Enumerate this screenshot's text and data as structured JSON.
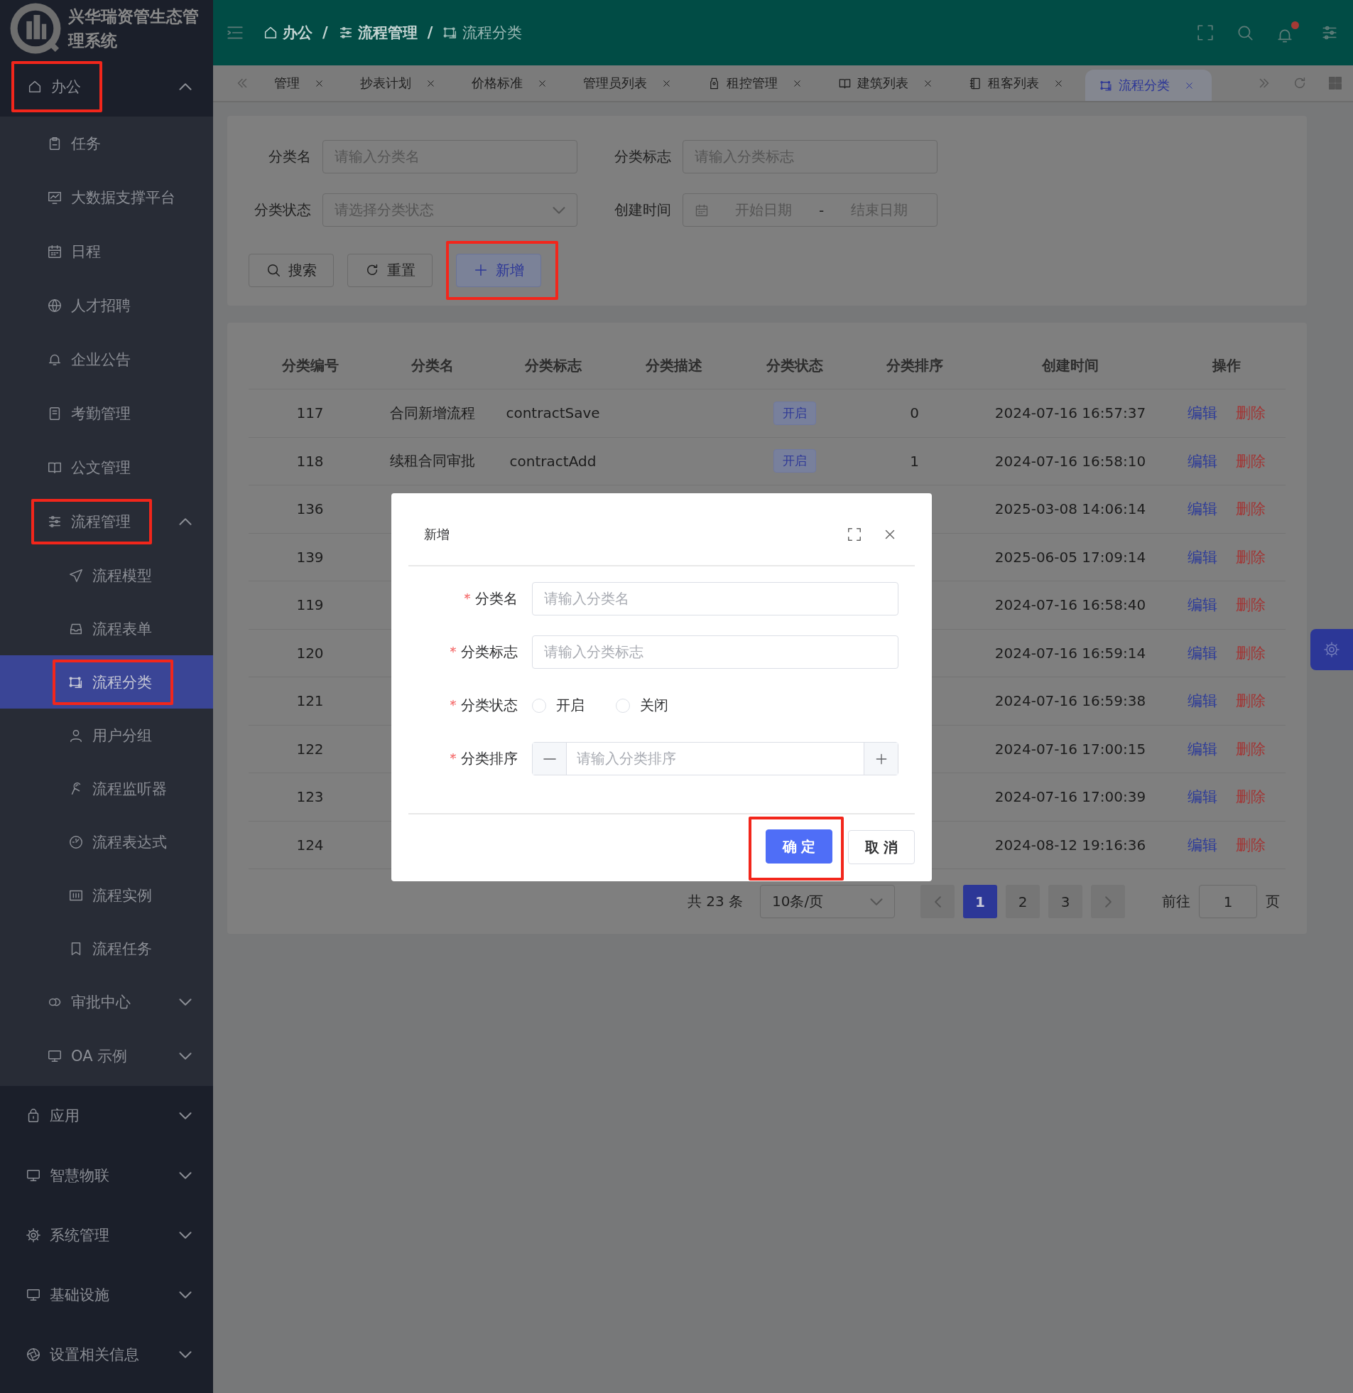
{
  "sidebar": {
    "title": "兴华瑞资管生态管理系统",
    "menu": [
      {
        "label": "办公",
        "expanded": true,
        "highlighted": true,
        "selected": false,
        "children": [
          {
            "label": "任务",
            "selected": false,
            "highlighted": false
          },
          {
            "label": "大数据支撑平台",
            "selected": false,
            "highlighted": false
          },
          {
            "label": "日程",
            "selected": false,
            "highlighted": false
          },
          {
            "label": "人才招聘",
            "selected": false,
            "highlighted": false
          },
          {
            "label": "企业公告",
            "selected": false,
            "highlighted": false
          },
          {
            "label": "考勤管理",
            "selected": false,
            "highlighted": false
          },
          {
            "label": "公文管理",
            "selected": false,
            "highlighted": false
          },
          {
            "label": "流程管理",
            "expanded": true,
            "highlighted": true,
            "selected": false,
            "children": [
              {
                "label": "流程模型",
                "selected": false,
                "highlighted": false
              },
              {
                "label": "流程表单",
                "selected": false,
                "highlighted": false
              },
              {
                "label": "流程分类",
                "selected": true,
                "highlighted": true
              },
              {
                "label": "用户分组",
                "selected": false,
                "highlighted": false
              },
              {
                "label": "流程监听器",
                "selected": false,
                "highlighted": false
              },
              {
                "label": "流程表达式",
                "selected": false,
                "highlighted": false
              },
              {
                "label": "流程实例",
                "selected": false,
                "highlighted": false
              },
              {
                "label": "流程任务",
                "selected": false,
                "highlighted": false
              }
            ]
          },
          {
            "label": "审批中心",
            "expanded": false,
            "highlighted": false,
            "selected": false
          },
          {
            "label": "OA 示例",
            "expanded": false,
            "highlighted": false,
            "selected": false
          }
        ]
      },
      {
        "label": "应用",
        "expanded": false,
        "highlighted": false,
        "selected": false
      },
      {
        "label": "智慧物联",
        "expanded": false,
        "highlighted": false,
        "selected": false
      },
      {
        "label": "系统管理",
        "expanded": false,
        "highlighted": false,
        "selected": false
      },
      {
        "label": "基础设施",
        "expanded": false,
        "highlighted": false,
        "selected": false
      },
      {
        "label": "设置相关信息",
        "expanded": false,
        "highlighted": false,
        "selected": false
      }
    ]
  },
  "breadcrumb": [
    {
      "label": "办公",
      "current": false
    },
    {
      "separator": "/",
      "label": "流程管理",
      "current": false
    },
    {
      "separator": "/",
      "label": "流程分类",
      "current": true
    }
  ],
  "header": {
    "notification_dot": true
  },
  "tabs": [
    {
      "label": "管理",
      "selected": false
    },
    {
      "label": "抄表计划",
      "selected": false
    },
    {
      "label": "价格标准",
      "selected": false
    },
    {
      "label": "管理员列表",
      "selected": false
    },
    {
      "label": "租控管理",
      "selected": false
    },
    {
      "label": "建筑列表",
      "selected": false
    },
    {
      "label": "租客列表",
      "selected": false
    },
    {
      "label": "流程分类",
      "selected": true
    }
  ],
  "filter": {
    "fields": [
      {
        "kind": "text",
        "label": "分类名",
        "placeholder": "请输入分类名"
      },
      {
        "kind": "text",
        "label": "分类标志",
        "placeholder": "请输入分类标志"
      },
      {
        "kind": "select",
        "label": "分类状态",
        "placeholder": "请选择分类状态"
      },
      {
        "kind": "daterange",
        "label": "创建时间",
        "start_placeholder": "开始日期",
        "separator": "-",
        "end_placeholder": "结束日期"
      }
    ],
    "buttons": [
      {
        "kind": "search",
        "label": "搜索",
        "highlighted": false
      },
      {
        "kind": "reset",
        "label": "重置",
        "highlighted": false
      },
      {
        "kind": "add",
        "label": "新增",
        "highlighted": true
      }
    ]
  },
  "table": {
    "columns": [
      "分类编号",
      "分类名",
      "分类标志",
      "分类描述",
      "分类状态",
      "分类排序",
      "创建时间",
      "操作"
    ],
    "rows": [
      {
        "id": "117",
        "name": "合同新增流程",
        "flag": "contractSave",
        "status": "开启",
        "sort": "0",
        "created": "2024-07-16 16:57:37",
        "actions": [
          "编辑",
          "删除"
        ]
      },
      {
        "id": "118",
        "name": "续租合同审批",
        "flag": "contractAdd",
        "status": "开启",
        "sort": "1",
        "created": "2024-07-16 16:58:10",
        "actions": [
          "编辑",
          "删除"
        ]
      },
      {
        "id": "136",
        "created": "2025-03-08 14:06:14",
        "actions": [
          "编辑",
          "删除"
        ]
      },
      {
        "id": "139",
        "created": "2025-06-05 17:09:14",
        "actions": [
          "编辑",
          "删除"
        ]
      },
      {
        "id": "119",
        "created": "2024-07-16 16:58:40",
        "actions": [
          "编辑",
          "删除"
        ]
      },
      {
        "id": "120",
        "created": "2024-07-16 16:59:14",
        "actions": [
          "编辑",
          "删除"
        ]
      },
      {
        "id": "121",
        "created": "2024-07-16 16:59:38",
        "actions": [
          "编辑",
          "删除"
        ]
      },
      {
        "id": "122",
        "created": "2024-07-16 17:00:15",
        "actions": [
          "编辑",
          "删除"
        ]
      },
      {
        "id": "123",
        "created": "2024-07-16 17:00:39",
        "actions": [
          "编辑",
          "删除"
        ]
      },
      {
        "id": "124",
        "created": "2024-08-12 19:16:36",
        "actions": [
          "编辑",
          "删除"
        ]
      }
    ]
  },
  "pagination": {
    "total": "共 23 条",
    "page_size": "10条/页",
    "pages": [
      {
        "label": "1",
        "selected": true
      },
      {
        "label": "2",
        "selected": false
      },
      {
        "label": "3",
        "selected": false
      }
    ],
    "goto_label": "前往",
    "goto_value": "1",
    "page_suffix": "页"
  },
  "dialog": {
    "title": "新增",
    "fields": [
      {
        "kind": "text",
        "label": "分类名",
        "required": true,
        "placeholder": "请输入分类名"
      },
      {
        "kind": "text",
        "label": "分类标志",
        "required": true,
        "placeholder": "请输入分类标志"
      },
      {
        "kind": "radio",
        "label": "分类状态",
        "required": true,
        "options": [
          {
            "label": "开启",
            "selected": false
          },
          {
            "label": "关闭",
            "selected": false
          }
        ]
      },
      {
        "kind": "number",
        "label": "分类排序",
        "required": true,
        "placeholder": "请输入分类排序"
      }
    ],
    "buttons": [
      {
        "kind": "primary",
        "label": "确 定",
        "highlighted": true
      },
      {
        "kind": "default",
        "label": "取 消",
        "highlighted": false
      }
    ]
  }
}
